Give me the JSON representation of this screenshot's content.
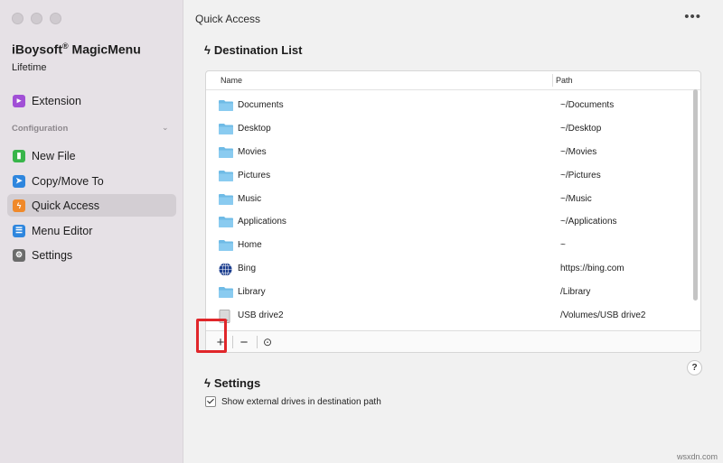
{
  "app": {
    "name": "iBoysoft",
    "reg": "®",
    "name2": " MagicMenu",
    "subtitle": "Lifetime"
  },
  "sidebar": {
    "extension": "Extension",
    "section_label": "Configuration",
    "items": [
      {
        "label": "New File"
      },
      {
        "label": "Copy/Move To"
      },
      {
        "label": "Quick Access"
      },
      {
        "label": "Menu Editor"
      },
      {
        "label": "Settings"
      }
    ]
  },
  "main": {
    "title": "Quick Access",
    "more": "•••",
    "destination_heading": "Destination List",
    "columns": {
      "name": "Name",
      "path": "Path"
    },
    "rows": [
      {
        "name": "Documents",
        "path": "~/Documents",
        "icon": "folder-icon"
      },
      {
        "name": "Desktop",
        "path": "~/Desktop",
        "icon": "folder-icon"
      },
      {
        "name": "Movies",
        "path": "~/Movies",
        "icon": "folder-icon"
      },
      {
        "name": "Pictures",
        "path": "~/Pictures",
        "icon": "folder-icon"
      },
      {
        "name": "Music",
        "path": "~/Music",
        "icon": "folder-icon"
      },
      {
        "name": "Applications",
        "path": "~/Applications",
        "icon": "folder-icon"
      },
      {
        "name": "Home",
        "path": "~",
        "icon": "folder-icon"
      },
      {
        "name": "Bing",
        "path": "https://bing.com",
        "icon": "globe-icon"
      },
      {
        "name": "Library",
        "path": "/Library",
        "icon": "folder-icon"
      },
      {
        "name": "USB drive2",
        "path": "/Volumes/USB drive2",
        "icon": "drive-icon"
      }
    ],
    "toolbar": {
      "add": "+",
      "remove": "−",
      "reveal": "⊙"
    },
    "help": "?",
    "settings_heading": "Settings",
    "show_external_label": "Show external drives in destination path"
  },
  "watermark": "wsxdn.com",
  "colors": {
    "accent": "#4ca6d8",
    "highlight": "#e0262a",
    "folder": "#6fbbe6"
  }
}
